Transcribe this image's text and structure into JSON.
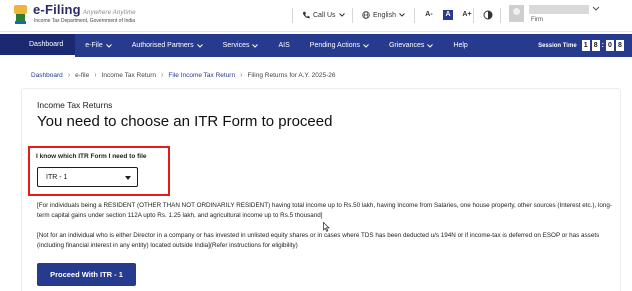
{
  "header": {
    "logo_title": "e-Filing",
    "logo_tagline": "Anywhere Anytime",
    "logo_subtitle": "Income Tax Department, Government of India",
    "call_us_label": "Call Us",
    "language_label": "English",
    "font_buttons": [
      "A-",
      "A",
      "A+"
    ],
    "user_role": "Firm"
  },
  "nav": {
    "items": [
      {
        "label": "Dashboard",
        "has_dropdown": false,
        "active": true
      },
      {
        "label": "e-File",
        "has_dropdown": true,
        "active": false
      },
      {
        "label": "Authorised Partners",
        "has_dropdown": true,
        "active": false
      },
      {
        "label": "Services",
        "has_dropdown": true,
        "active": false
      },
      {
        "label": "AIS",
        "has_dropdown": false,
        "active": false
      },
      {
        "label": "Pending Actions",
        "has_dropdown": true,
        "active": false
      },
      {
        "label": "Grievances",
        "has_dropdown": true,
        "active": false
      },
      {
        "label": "Help",
        "has_dropdown": false,
        "active": false
      }
    ],
    "session_label": "Session Time",
    "session_digits": [
      "1",
      "8",
      "0",
      "8"
    ]
  },
  "breadcrumb": [
    "Dashboard",
    "e-file",
    "Income Tax Return",
    "File Income Tax Return",
    "Filing Returns for A.Y. 2025-26"
  ],
  "page": {
    "eyebrow": "Income Tax Returns",
    "headline": "You need to choose an ITR Form to proceed",
    "field_label": "I know which ITR Form I need to file",
    "selected_form": "ITR - 1",
    "para1": "[For individuals being a RESIDENT (OTHER THAN NOT ORDINARILY RESIDENT) having total income up to Rs.50 lakh, having Income from Salaries, one house property, other sources (Interest etc.), long-term capital gains under section 112A upto Rs. 1.25 lakh, and agricultural income up to Rs.5 thousand]",
    "para2": "[Not for an individual who is either Director in a company or has invested in unlisted equity shares or in cases where TDS has been deducted u/s 194N or if income-tax is deferred on ESOP or has assets (including financial interest in any entity) located outside India](Refer instructions for eligibility)",
    "proceed_button": "Proceed With ITR - 1"
  },
  "colors": {
    "brand_navy": "#263a8e",
    "highlight_red": "#e51a1a"
  }
}
